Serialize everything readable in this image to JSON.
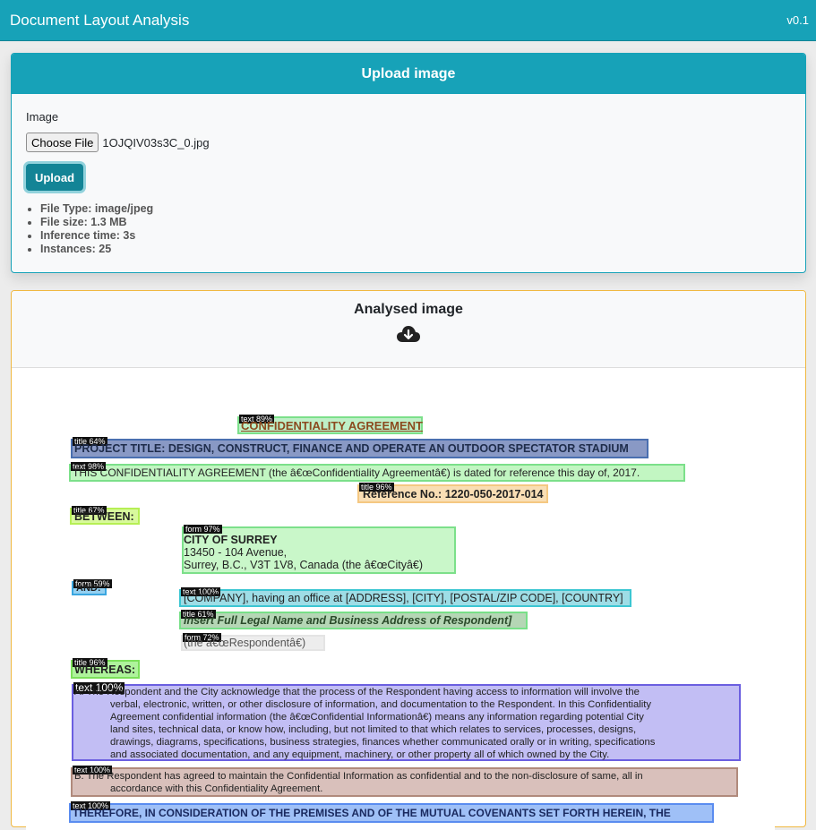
{
  "navbar": {
    "title": "Document Layout Analysis",
    "version": "v0.1"
  },
  "upload_card": {
    "header": "Upload image",
    "field_label": "Image",
    "choose_file_label": "Choose File",
    "file_name": "1OJQIV03s3C_0.jpg",
    "upload_label": "Upload",
    "meta": [
      "File Type: image/jpeg",
      "File size: 1.3 MB",
      "Inference time: 3s",
      "Instances: 25"
    ]
  },
  "analysed_card": {
    "header": "Analysed image",
    "download_icon": "cloud-download-icon"
  },
  "document": {
    "labels": {
      "l1": "text 89%",
      "l2": "title 64%",
      "l3": "text 98%",
      "l4": "title 96%",
      "l5": "title 67%",
      "l6": "form 97%",
      "l7": "form 59%",
      "l8": "text 100%",
      "l9": "title 61%",
      "l10": "form 72%",
      "l11": "title 96%",
      "l12": "text 100%",
      "l13": "text 100%",
      "l14": "text 100%"
    },
    "lines": {
      "agreement_title": "CONFIDENTIALITY AGREEMENT",
      "project_title": "PROJECT TITLE: DESIGN, CONSTRUCT, FINANCE AND OPERATE AN OUTDOOR SPECTATOR STADIUM",
      "this_line": "THIS CONFIDENTIALITY AGREEMENT (the â€œConfidentiality Agreementâ€) is dated for reference this day of, 2017.",
      "reference": "Reference No.: 1220-050-2017-014",
      "between": "BETWEEN:",
      "city_name": "CITY OF SURREY",
      "city_addr1": "13450 - 104 Avenue,",
      "city_addr2": "Surrey, B.C., V3T 1V8, Canada (the â€œCityâ€)",
      "and": "AND:",
      "company": "[COMPANY], having an office at [ADDRESS], [CITY], [POSTAL/ZIP CODE], [COUNTRY]",
      "respondent_name": "Insert Full Legal Name and Business Address of Respondent]",
      "respondent": "(the â€œRespondentâ€)",
      "whereas": "WHEREAS:",
      "para_a1": "A. The Respondent and the City acknowledge that the process of the Respondent having access to information will involve the",
      "para_a2": "verbal, electronic, written, or other disclosure of information, and documentation to the Respondent. In this Confidentiality",
      "para_a3": "Agreement confidential information (the â€œConfidential Informationâ€) means any information regarding potential City",
      "para_a4": "land sites, technical data, or know how, including, but not limited to that which relates to services, processes, designs,",
      "para_a5": "drawings, diagrams, specifications, business strategies, finances whether communicated orally or in writing, specifications",
      "para_a6": "and associated documentation, and any equipment, machinery, or other property all of which owned by the City.",
      "para_b1": "B. The Respondent has agreed to maintain the Confidential Information as confidential and to the non-disclosure of same, all in",
      "para_b2": "accordance with this Confidentiality Agreement.",
      "therefore": "THEREFORE, IN CONSIDERATION OF THE PREMISES AND OF THE MUTUAL COVENANTS SET FORTH HEREIN, THE"
    }
  }
}
